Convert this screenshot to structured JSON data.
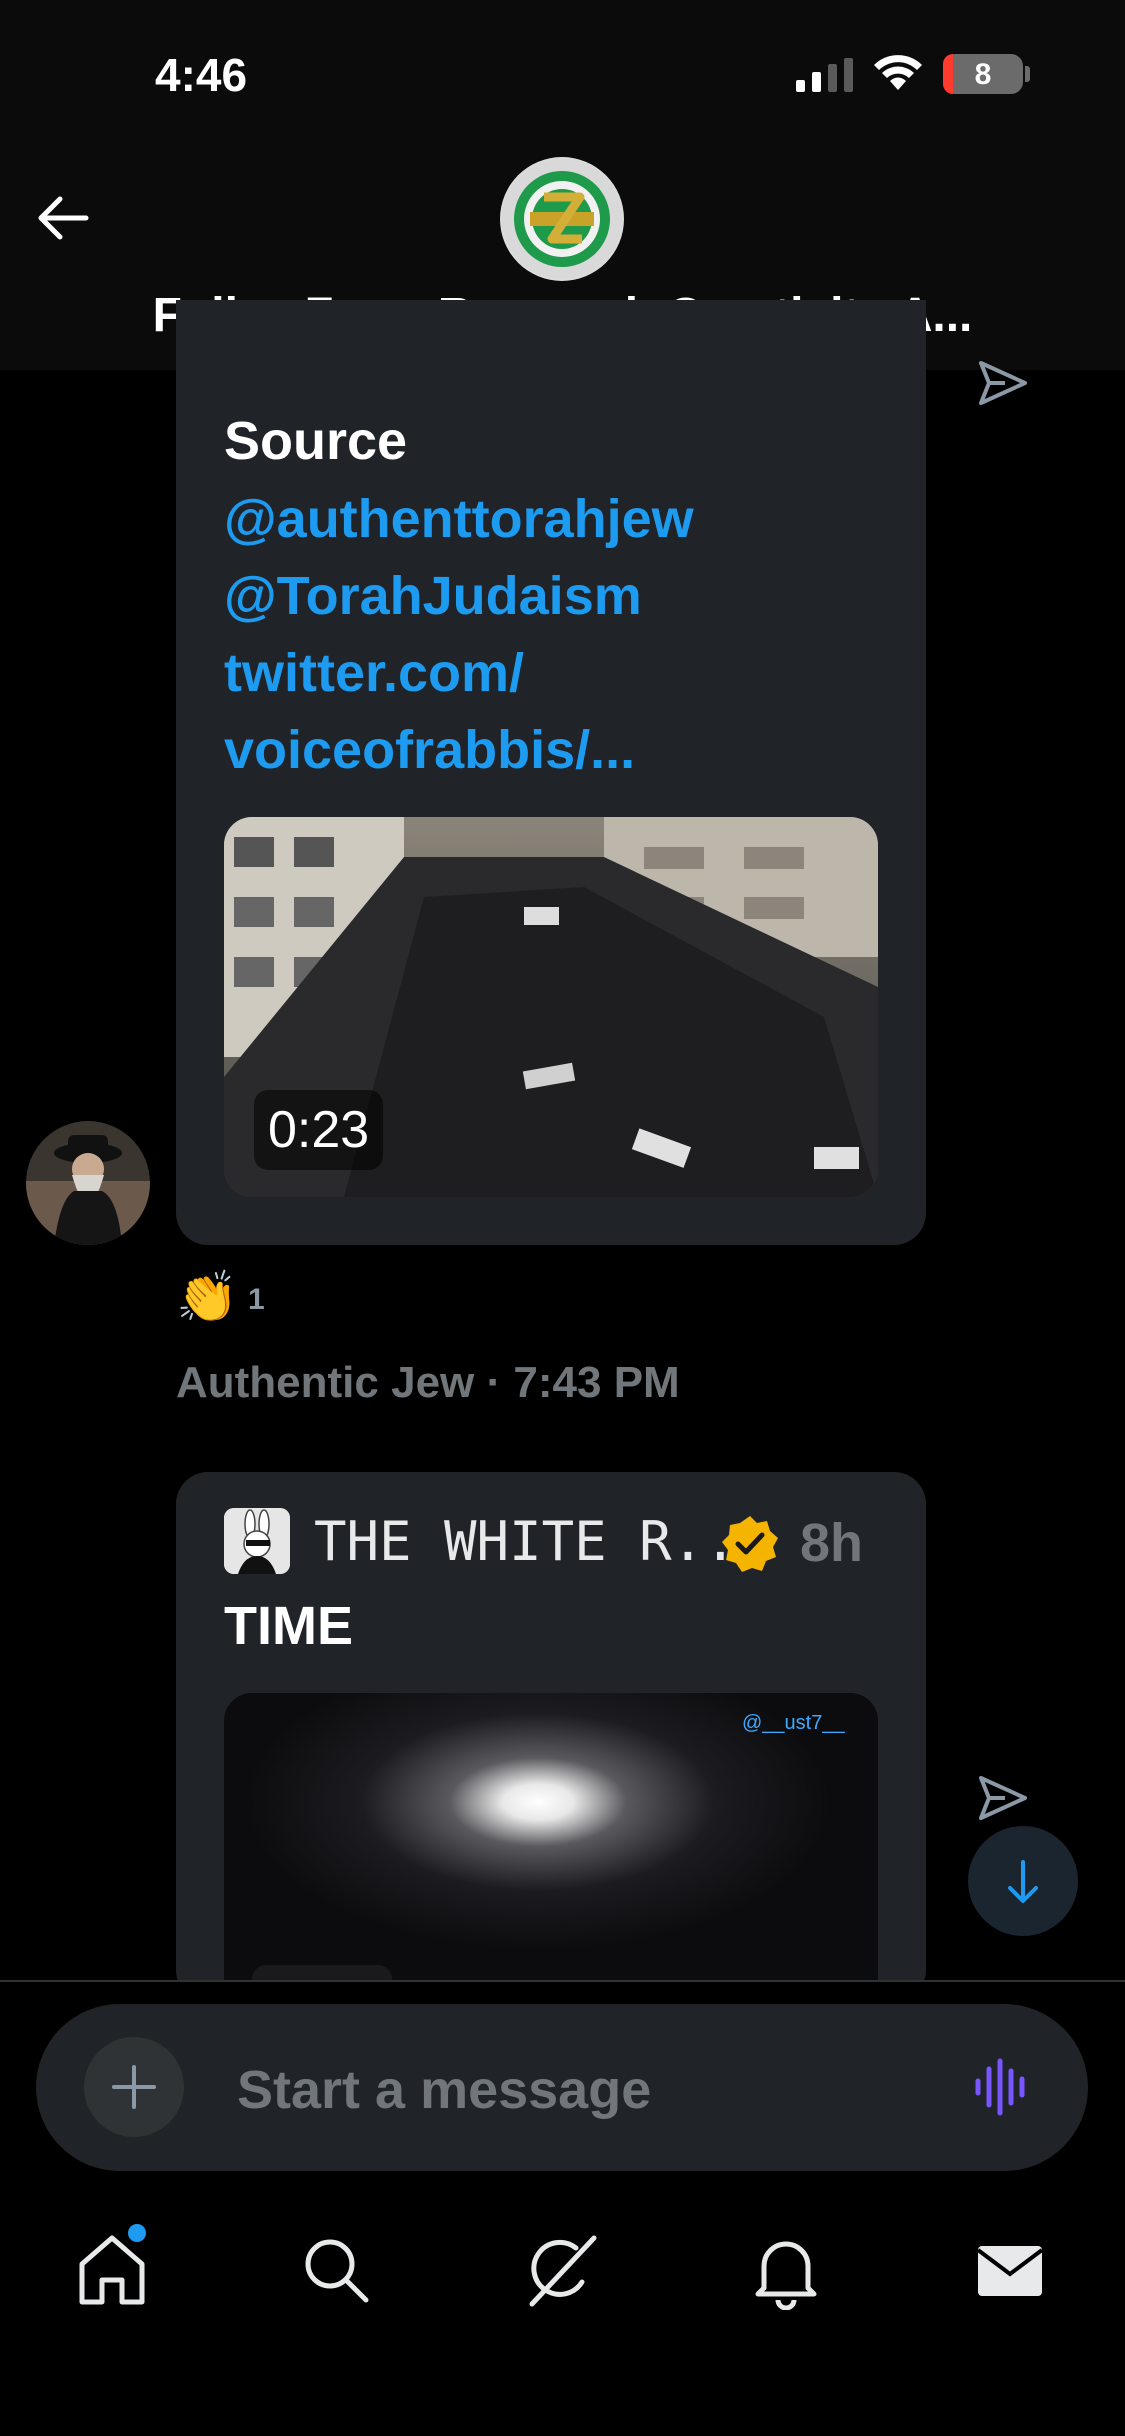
{
  "status_bar": {
    "time": "4:46",
    "battery": "8"
  },
  "header": {
    "title": "FollowZ.org Research Creativity A..."
  },
  "message1": {
    "source_label": "Source",
    "links": [
      "@authenttorahjew",
      "@TorahJudaism",
      "twitter.com/",
      "voiceofrabbis/..."
    ],
    "video_duration": "0:23",
    "reaction_emoji": "👏",
    "reaction_count": "1",
    "sender": "Authentic Jew",
    "time": "7:43 PM"
  },
  "message2": {
    "quoted_name": "THE WHITE R...",
    "quoted_age": "8h",
    "text": "TIME",
    "watermark": "@__ust7__"
  },
  "composer": {
    "placeholder": "Start a message"
  },
  "colors": {
    "accent": "#1d9bf0",
    "bubble": "#202327",
    "voice": "#7856ff",
    "badge": "#f4b400"
  },
  "icons": [
    "back-arrow-icon",
    "send-icon",
    "scroll-down-icon",
    "plus-icon",
    "voice-icon",
    "home-icon",
    "search-icon",
    "grok-icon",
    "bell-icon",
    "mail-icon"
  ]
}
